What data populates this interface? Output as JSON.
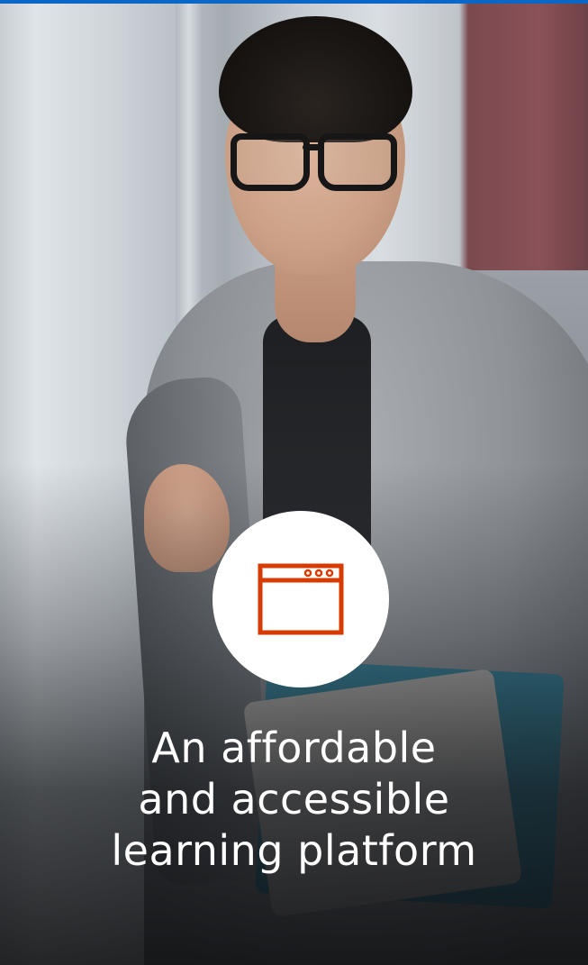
{
  "promo": {
    "headline_lines": [
      "An affordable",
      "and accessible",
      "learning platform"
    ],
    "icon": "browser-window-icon",
    "accent_color": "#d83b01",
    "top_bar_color": "#0b67c7"
  }
}
